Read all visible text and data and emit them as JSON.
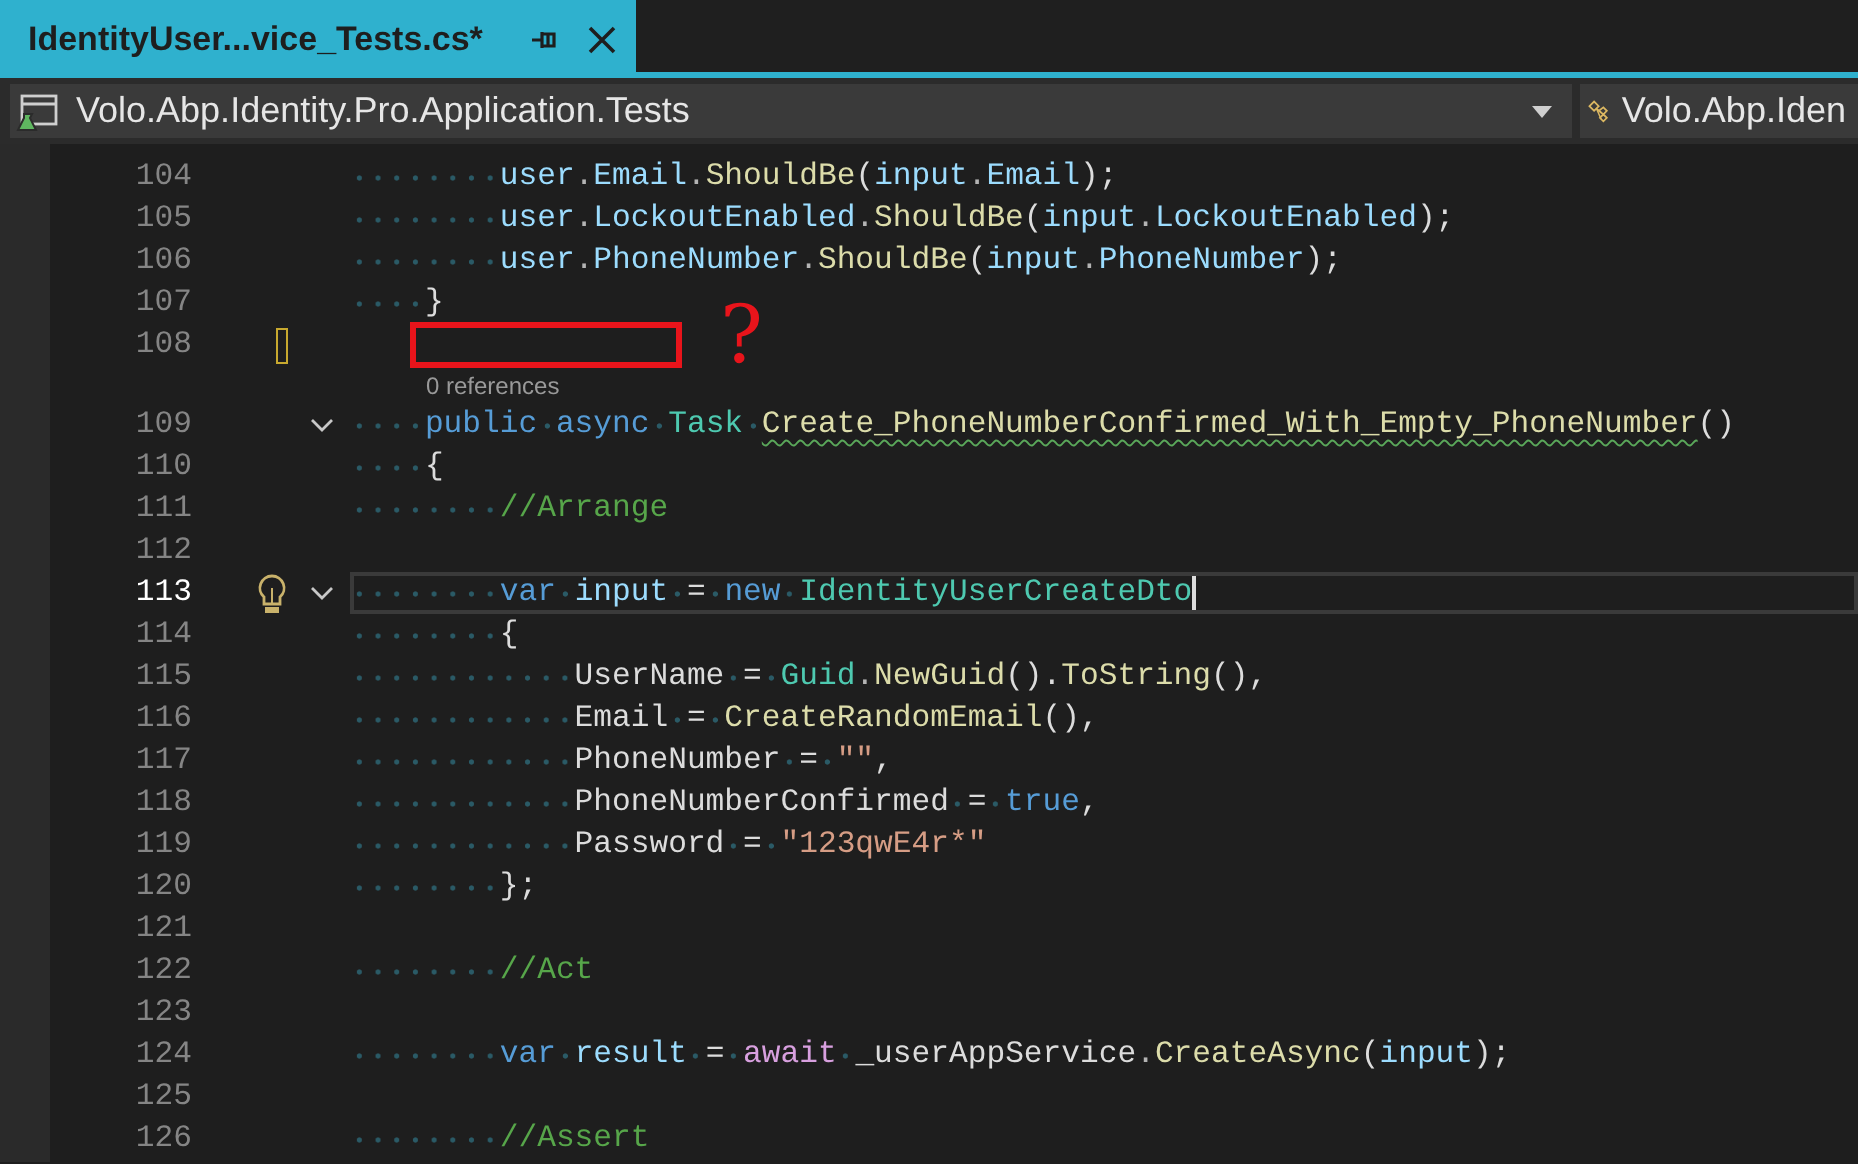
{
  "tabs": [
    {
      "title": "IdentityUser...vice_Tests.cs*",
      "selected": true
    }
  ],
  "navigation": {
    "project": "Volo.Abp.Identity.Pro.Application.Tests",
    "member": "Volo.Abp.Iden"
  },
  "lines": [
    {
      "number": "104",
      "tokens": [
        {
          "text": "        user",
          "kind": "var"
        },
        {
          "text": ".",
          "kind": "punct"
        },
        {
          "text": "Email",
          "kind": "var"
        },
        {
          "text": ".",
          "kind": "punct"
        },
        {
          "text": "ShouldBe",
          "kind": "method"
        },
        {
          "text": "(",
          "kind": "plain"
        },
        {
          "text": "input",
          "kind": "var"
        },
        {
          "text": ".",
          "kind": "punct"
        },
        {
          "text": "Email",
          "kind": "var"
        },
        {
          "text": ");",
          "kind": "plain"
        }
      ]
    },
    {
      "number": "105",
      "tokens": [
        {
          "text": "        user",
          "kind": "var"
        },
        {
          "text": ".",
          "kind": "punct"
        },
        {
          "text": "LockoutEnabled",
          "kind": "var"
        },
        {
          "text": ".",
          "kind": "punct"
        },
        {
          "text": "ShouldBe",
          "kind": "method"
        },
        {
          "text": "(",
          "kind": "plain"
        },
        {
          "text": "input",
          "kind": "var"
        },
        {
          "text": ".",
          "kind": "punct"
        },
        {
          "text": "LockoutEnabled",
          "kind": "var"
        },
        {
          "text": ");",
          "kind": "plain"
        }
      ]
    },
    {
      "number": "106",
      "tokens": [
        {
          "text": "        user",
          "kind": "var"
        },
        {
          "text": ".",
          "kind": "punct"
        },
        {
          "text": "PhoneNumber",
          "kind": "var"
        },
        {
          "text": ".",
          "kind": "punct"
        },
        {
          "text": "ShouldBe",
          "kind": "method"
        },
        {
          "text": "(",
          "kind": "plain"
        },
        {
          "text": "input",
          "kind": "var"
        },
        {
          "text": ".",
          "kind": "punct"
        },
        {
          "text": "PhoneNumber",
          "kind": "var"
        },
        {
          "text": ");",
          "kind": "plain"
        }
      ]
    },
    {
      "number": "107",
      "tokens": [
        {
          "text": "    }",
          "kind": "plain"
        }
      ]
    },
    {
      "number": "108",
      "changed": true,
      "annotation": {
        "note": "?"
      }
    },
    {
      "number": "109",
      "foldable": true,
      "codelens": "0 references",
      "tokens": [
        {
          "text": "    public async ",
          "kind": "keyword"
        },
        {
          "text": "Task ",
          "kind": "type"
        },
        {
          "text": "Create_PhoneNumberConfirmed_With_Empty_PhoneNumber",
          "kind": "method",
          "squiggle": true
        },
        {
          "text": "()",
          "kind": "plain"
        }
      ]
    },
    {
      "number": "110",
      "tokens": [
        {
          "text": "    {",
          "kind": "plain"
        }
      ]
    },
    {
      "number": "111",
      "tokens": [
        {
          "text": "        //Arrange",
          "kind": "comment"
        }
      ]
    },
    {
      "number": "112"
    },
    {
      "number": "113",
      "current": true,
      "lightbulb": true,
      "foldable": true,
      "caret": true,
      "tokens": [
        {
          "text": "        var ",
          "kind": "keyword"
        },
        {
          "text": "input",
          "kind": "var"
        },
        {
          "text": " = ",
          "kind": "plain"
        },
        {
          "text": "new ",
          "kind": "keyword"
        },
        {
          "text": "IdentityUserCreateDto",
          "kind": "type"
        }
      ]
    },
    {
      "number": "114",
      "tokens": [
        {
          "text": "        {",
          "kind": "plain"
        }
      ]
    },
    {
      "number": "115",
      "tokens": [
        {
          "text": "            UserName",
          "kind": "plain"
        },
        {
          "text": " = ",
          "kind": "plain"
        },
        {
          "text": "Guid",
          "kind": "type"
        },
        {
          "text": ".",
          "kind": "punct"
        },
        {
          "text": "NewGuid",
          "kind": "method"
        },
        {
          "text": "().",
          "kind": "plain"
        },
        {
          "text": "ToString",
          "kind": "method"
        },
        {
          "text": "(),",
          "kind": "plain"
        }
      ]
    },
    {
      "number": "116",
      "tokens": [
        {
          "text": "            Email",
          "kind": "plain"
        },
        {
          "text": " = ",
          "kind": "plain"
        },
        {
          "text": "CreateRandomEmail",
          "kind": "method"
        },
        {
          "text": "(),",
          "kind": "plain"
        }
      ]
    },
    {
      "number": "117",
      "tokens": [
        {
          "text": "            PhoneNumber",
          "kind": "plain"
        },
        {
          "text": " = ",
          "kind": "plain"
        },
        {
          "text": "\"\"",
          "kind": "string"
        },
        {
          "text": ",",
          "kind": "plain"
        }
      ]
    },
    {
      "number": "118",
      "tokens": [
        {
          "text": "            PhoneNumberConfirmed",
          "kind": "plain"
        },
        {
          "text": " = ",
          "kind": "plain"
        },
        {
          "text": "true",
          "kind": "keyword"
        },
        {
          "text": ",",
          "kind": "plain"
        }
      ]
    },
    {
      "number": "119",
      "tokens": [
        {
          "text": "            Password",
          "kind": "plain"
        },
        {
          "text": " = ",
          "kind": "plain"
        },
        {
          "text": "\"123qwE4r*\"",
          "kind": "string"
        }
      ]
    },
    {
      "number": "120",
      "tokens": [
        {
          "text": "        };",
          "kind": "plain"
        }
      ]
    },
    {
      "number": "121"
    },
    {
      "number": "122",
      "tokens": [
        {
          "text": "        //Act",
          "kind": "comment"
        }
      ]
    },
    {
      "number": "123"
    },
    {
      "number": "124",
      "tokens": [
        {
          "text": "        var ",
          "kind": "keyword"
        },
        {
          "text": "result",
          "kind": "var"
        },
        {
          "text": " = ",
          "kind": "plain"
        },
        {
          "text": "await ",
          "kind": "control"
        },
        {
          "text": "_userAppService",
          "kind": "plain"
        },
        {
          "text": ".",
          "kind": "punct"
        },
        {
          "text": "CreateAsync",
          "kind": "method"
        },
        {
          "text": "(",
          "kind": "plain"
        },
        {
          "text": "input",
          "kind": "var"
        },
        {
          "text": ");",
          "kind": "plain"
        }
      ]
    },
    {
      "number": "125"
    },
    {
      "number": "126",
      "tokens": [
        {
          "text": "        //Assert",
          "kind": "comment"
        }
      ]
    }
  ]
}
